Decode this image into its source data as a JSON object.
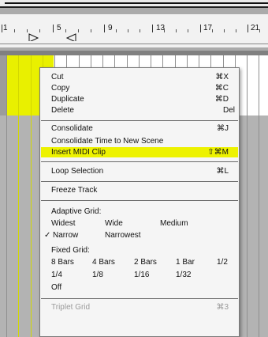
{
  "ruler": {
    "bar_numbers": [
      "1",
      "5",
      "9",
      "13",
      "17",
      "21"
    ]
  },
  "colors": {
    "clip": "#e9f000",
    "highlight": "#edf200",
    "menu_bg": "#f5f5f5"
  },
  "menu": {
    "items": [
      {
        "label": "Cut",
        "shortcut": "⌘X"
      },
      {
        "label": "Copy",
        "shortcut": "⌘C"
      },
      {
        "label": "Duplicate",
        "shortcut": "⌘D"
      },
      {
        "label": "Delete",
        "shortcut": "Del"
      },
      {
        "label": "Consolidate",
        "shortcut": "⌘J"
      },
      {
        "label": "Consolidate Time to New Scene",
        "shortcut": ""
      },
      {
        "label": "Insert MIDI Clip",
        "shortcut": "⇧⌘M"
      },
      {
        "label": "Loop Selection",
        "shortcut": "⌘L"
      },
      {
        "label": "Freeze Track",
        "shortcut": ""
      }
    ],
    "adaptive_grid": {
      "header": "Adaptive Grid:",
      "options": [
        "Widest",
        "Wide",
        "Medium",
        "Narrow",
        "Narrowest"
      ],
      "selected": "Narrow",
      "check_mark": "✓"
    },
    "fixed_grid": {
      "header": "Fixed Grid:",
      "options": [
        "8 Bars",
        "4 Bars",
        "2 Bars",
        "1 Bar",
        "1/2",
        "1/4",
        "1/8",
        "1/16",
        "1/32",
        "Off"
      ]
    },
    "triplet": {
      "label": "Triplet Grid",
      "shortcut": "⌘3"
    }
  }
}
